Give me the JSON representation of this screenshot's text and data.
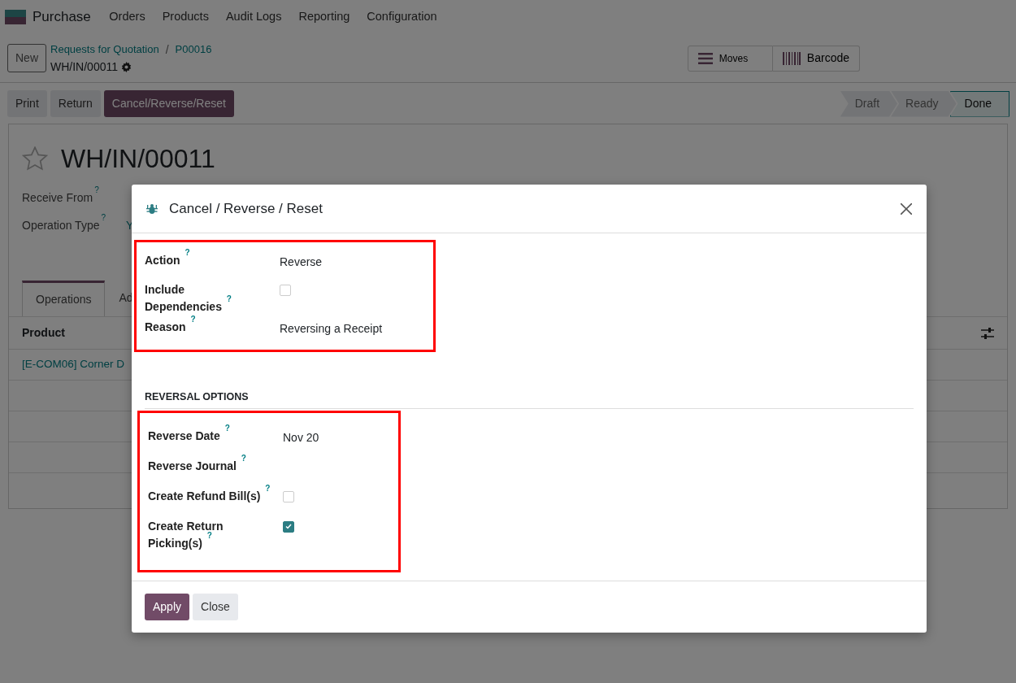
{
  "navbar": {
    "app": "Purchase",
    "menu": [
      "Orders",
      "Products",
      "Audit Logs",
      "Reporting",
      "Configuration"
    ]
  },
  "control_panel": {
    "new_button": "New",
    "breadcrumbs": [
      "Requests for Quotation",
      "P00016"
    ],
    "breadcrumb_separator": "/",
    "record": "WH/IN/00011",
    "smart_buttons": [
      {
        "label": "Moves",
        "kind": "list"
      },
      {
        "label": "Barcode",
        "kind": "barcode"
      }
    ]
  },
  "action_buttons": [
    {
      "label": "Print",
      "kind": "secondary"
    },
    {
      "label": "Return",
      "kind": "secondary"
    },
    {
      "label": "Cancel/Reverse/Reset",
      "kind": "primary"
    }
  ],
  "status_bar": [
    {
      "label": "Draft",
      "selected": false
    },
    {
      "label": "Ready",
      "selected": false
    },
    {
      "label": "Done",
      "selected": true
    }
  ],
  "form": {
    "title": "WH/IN/00011",
    "starred": false,
    "fields": [
      {
        "label": "Receive From",
        "help": "?"
      },
      {
        "label": "Operation Type",
        "help": "?",
        "value": "Y"
      }
    ],
    "tabs": [
      {
        "label": "Operations",
        "selected": true
      },
      {
        "label": "Ad",
        "selected": false
      }
    ],
    "table": {
      "columns": [
        "Product"
      ],
      "rows": [
        [
          "[E-COM06] Corner D"
        ]
      ]
    }
  },
  "dialog": {
    "title": "Cancel / Reverse / Reset",
    "sections": [
      {
        "highlighted": true,
        "fields": [
          {
            "label": "Action",
            "help": "?",
            "kind": "text",
            "value": "Reverse"
          },
          {
            "label": "Include Dependencies",
            "help": "?",
            "kind": "checkbox",
            "checked": false
          },
          {
            "label": "Reason",
            "help": "?",
            "kind": "text",
            "value": "Reversing a Receipt"
          }
        ]
      },
      {
        "heading": "REVERSAL OPTIONS",
        "highlighted": true,
        "fields": [
          {
            "label": "Reverse Date",
            "help": "?",
            "kind": "text",
            "value": "Nov 20"
          },
          {
            "label": "Reverse Journal",
            "help": "?",
            "kind": "text"
          },
          {
            "label": "Create Refund Bill(s)",
            "help": "?",
            "kind": "checkbox",
            "checked": false
          },
          {
            "label": "Create Return Picking(s)",
            "help": "?",
            "kind": "checkbox",
            "checked": true
          }
        ]
      }
    ],
    "buttons": [
      {
        "label": "Apply",
        "kind": "primary"
      },
      {
        "label": "Close",
        "kind": "secondary"
      }
    ]
  }
}
